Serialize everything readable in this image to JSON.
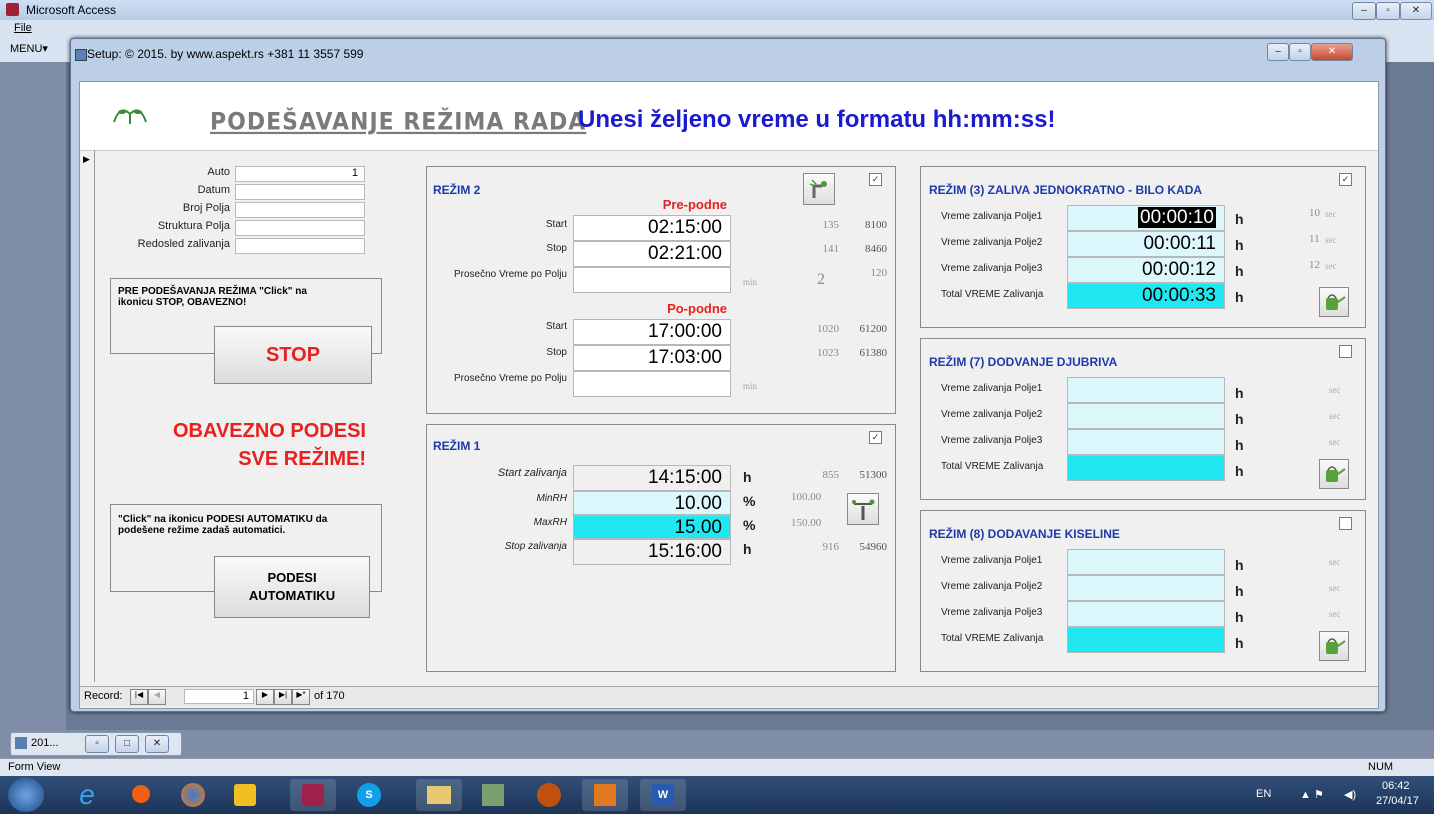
{
  "access": {
    "title": "Microsoft Access",
    "menu_file": "File",
    "menu_menu": "MENU"
  },
  "child": {
    "title": "Setup: © 2015. by www.aspekt.rs +381 11 3557 599"
  },
  "header": {
    "title": "PODEŠAVANJE REŽIMA RADA",
    "message": "Unesi željeno vreme u formatu hh:mm:ss!"
  },
  "left": {
    "fields": [
      {
        "label": "Auto",
        "value": "1"
      },
      {
        "label": "Datum",
        "value": ""
      },
      {
        "label": "Broj Polja",
        "value": ""
      },
      {
        "label": "Struktura Polja",
        "value": ""
      },
      {
        "label": "Redosled zalivanja",
        "value": ""
      }
    ],
    "stop_note": "PRE PODEŠAVANJA REŽIMA \"Click\" na ikonicu STOP, OBAVEZNO!",
    "stop_label": "STOP",
    "warn_line1": "OBAVEZNO PODESI",
    "warn_line2": "SVE REŽIME!",
    "auto_note": "\"Click\" na ikonicu PODESI AUTOMATIKU da podešene režime zadaš automatici.",
    "auto_label1": "PODESI",
    "auto_label2": "AUTOMATIKU"
  },
  "rezim2": {
    "title": "REŽIM 2",
    "checked": "✓",
    "am_label": "Pre-podne",
    "pm_label": "Po-podne",
    "start_label": "Start",
    "stop_label": "Stop",
    "avg_label": "Prosečno Vreme po Polju",
    "min_unit": "min",
    "am_start": "02:15:00",
    "am_stop": "02:21:00",
    "am_start_min": "135",
    "am_start_sec": "8100",
    "am_stop_min": "141",
    "am_stop_sec": "8460",
    "am_avg_n": "2",
    "am_avg_v": "120",
    "pm_start": "17:00:00",
    "pm_stop": "17:03:00",
    "pm_start_min": "1020",
    "pm_start_sec": "61200",
    "pm_stop_min": "1023",
    "pm_stop_sec": "61380"
  },
  "rezim1": {
    "title": "REŽIM 1",
    "checked": "✓",
    "rows": [
      {
        "label": "Start zalivanja",
        "value": "14:15:00",
        "unit": "h",
        "a": "855",
        "b": "51300"
      },
      {
        "label": "MinRH",
        "value": "10.00",
        "unit": "%",
        "a": "100.00",
        "b": ""
      },
      {
        "label": "MaxRH",
        "value": "15.00",
        "unit": "%",
        "a": "150.00",
        "b": ""
      },
      {
        "label": "Stop zalivanja",
        "value": "15:16:00",
        "unit": "h",
        "a": "916",
        "b": "54960"
      }
    ]
  },
  "rezim3": {
    "title": "REŽIM (3) ZALIVA JEDNOKRATNO - BILO KADA",
    "checked": "✓",
    "rows": [
      {
        "label": "Vreme zalivanja Polje1",
        "value": "00:00:10",
        "unit": "h",
        "sec_n": "10",
        "sec": "sec"
      },
      {
        "label": "Vreme zalivanja Polje2",
        "value": "00:00:11",
        "unit": "h",
        "sec_n": "11",
        "sec": "sec"
      },
      {
        "label": "Vreme zalivanja Polje3",
        "value": "00:00:12",
        "unit": "h",
        "sec_n": "12",
        "sec": "sec"
      },
      {
        "label": "Total VREME Zalivanja",
        "value": "00:00:33",
        "unit": "h",
        "sec_n": "",
        "sec": ""
      }
    ]
  },
  "rezim7": {
    "title": "REŽIM (7) DODVANJE DJUBRIVA",
    "checked": "",
    "rows": [
      {
        "label": "Vreme zalivanja Polje1",
        "unit": "h",
        "sec": "sec"
      },
      {
        "label": "Vreme zalivanja Polje2",
        "unit": "h",
        "sec": "sec"
      },
      {
        "label": "Vreme zalivanja Polje3",
        "unit": "h",
        "sec": "sec"
      },
      {
        "label": "Total VREME Zalivanja",
        "unit": "h",
        "sec": ""
      }
    ]
  },
  "rezim8": {
    "title": "REŽIM (8) DODAVANJE KISELINE",
    "checked": "",
    "rows": [
      {
        "label": "Vreme zalivanja Polje1",
        "unit": "h",
        "sec": "sec"
      },
      {
        "label": "Vreme zalivanja Polje2",
        "unit": "h",
        "sec": "sec"
      },
      {
        "label": "Vreme zalivanja Polje3",
        "unit": "h",
        "sec": "sec"
      },
      {
        "label": "Total VREME Zalivanja",
        "unit": "h",
        "sec": ""
      }
    ]
  },
  "record_nav": {
    "label": "Record:",
    "current": "1",
    "of": "of 170"
  },
  "minimized": {
    "label": "201..."
  },
  "status": {
    "view": "Form View",
    "num": "NUM"
  },
  "tray": {
    "lang": "EN",
    "time": "06:42",
    "date": "27/04/17"
  },
  "colors": {
    "cyan_light": "#dcf8fc",
    "cyan": "#20e8f0",
    "red": "#e8201e",
    "blue": "#1a1ad0"
  }
}
